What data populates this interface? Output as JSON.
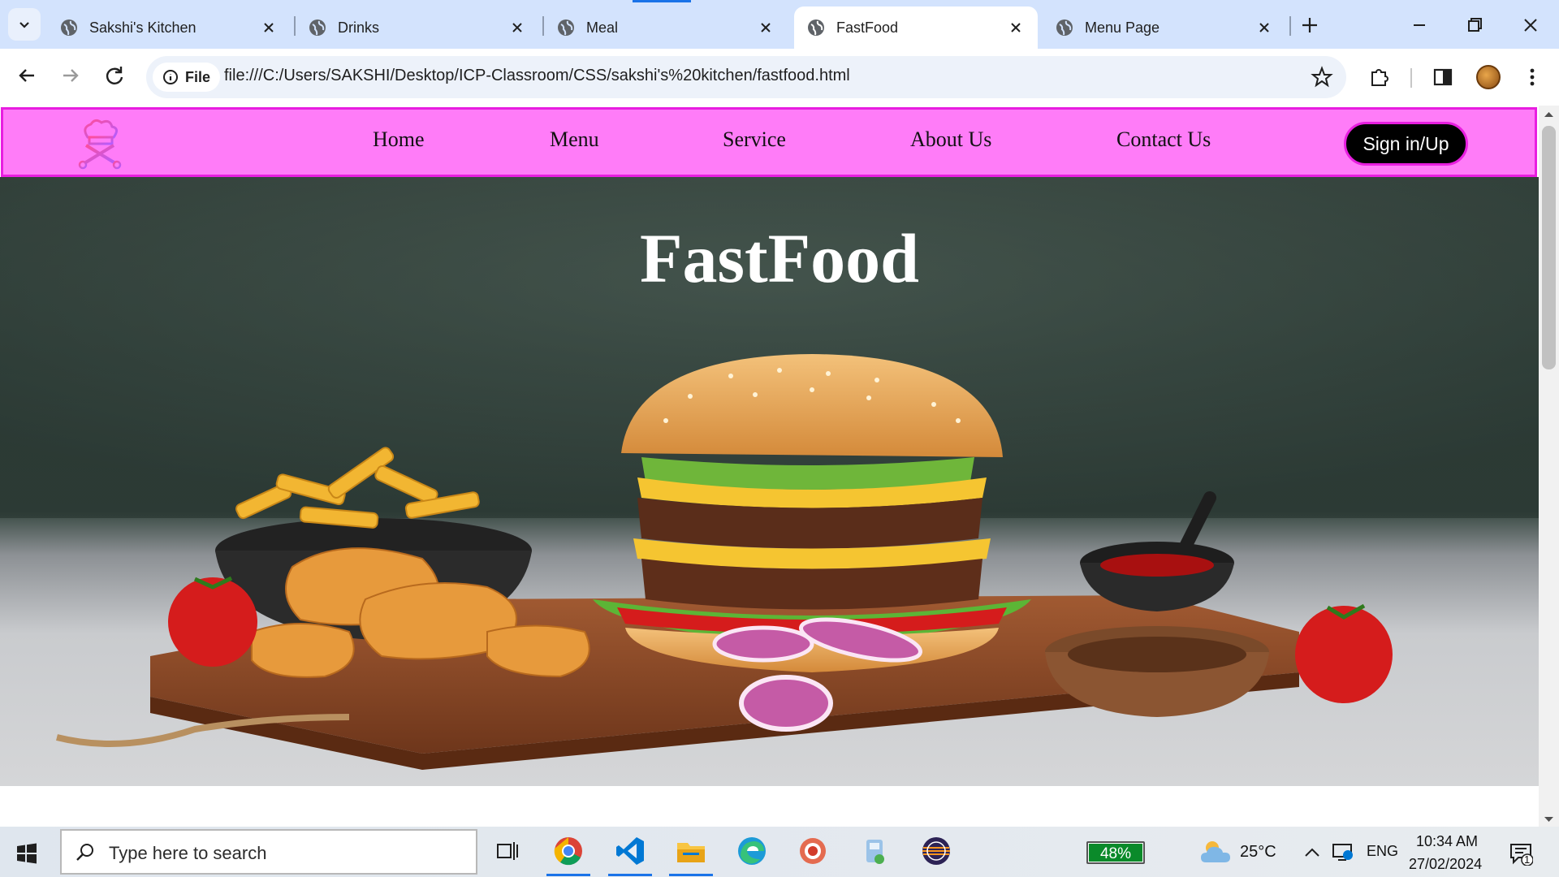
{
  "browser": {
    "tabs": [
      {
        "title": "Sakshi's Kitchen",
        "active": false
      },
      {
        "title": "Drinks",
        "active": false
      },
      {
        "title": "Meal",
        "active": false
      },
      {
        "title": "FastFood",
        "active": true
      },
      {
        "title": "Menu Page",
        "active": false
      }
    ],
    "site_info_label": "File",
    "url": "file:///C:/Users/SAKSHI/Desktop/ICP-Classroom/CSS/sakshi's%20kitchen/fastfood.html"
  },
  "site": {
    "nav": {
      "links": [
        "Home",
        "Menu",
        "Service",
        "About Us",
        "Contact Us"
      ],
      "signin_label": "Sign in/Up"
    },
    "hero": {
      "title": "FastFood",
      "image_description_icon": "burger-fries-image"
    },
    "colors": {
      "nav_bg": "#ff7cf8",
      "nav_border": "#e81ee0",
      "signin_bg": "#000000"
    }
  },
  "taskbar": {
    "search_placeholder": "Type here to search",
    "battery_percent": "48%",
    "battery_level": 0.48,
    "temperature": "25°C",
    "language": "ENG",
    "time": "10:34 AM",
    "date": "27/02/2024",
    "notification_count": "1"
  }
}
